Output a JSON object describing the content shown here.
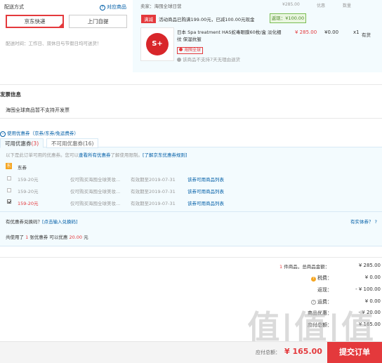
{
  "delivery": {
    "section_label": "配送方式",
    "link_label": "对应商品",
    "options": [
      "京东快递",
      "上门自提"
    ],
    "note": "配送时间：工作日、双休日与节假日均可送货！"
  },
  "shop": {
    "seller_prefix": "卖家：",
    "seller_name": "海囤全球日营",
    "header_cols": [
      "¥285.00",
      "优惠",
      "数量"
    ],
    "promo_tag": "满减",
    "promo_text": "活动商品已购满199.00元，已减100.00元现金",
    "promo_btn": "返现：¥100.00",
    "item": {
      "title": "日本 Spa treatment HAS蛇毒眼膜60枚/盒 淡化细纹 保湿抗皱",
      "price": "¥ 285.00",
      "discount": "¥0.00",
      "qty": "x1",
      "stock": "有货",
      "badge": "海囤全球",
      "return_note": "该商品不支持7天无理由退货",
      "logo_text": "S+"
    }
  },
  "invoice": {
    "title": "发票信息",
    "note": "海囤全球商品暂不支持开发票"
  },
  "coupons": {
    "header": "使用优惠券（京券/东券/免运费券）",
    "tabs": [
      {
        "label": "可用优惠券",
        "count": "(3)"
      },
      {
        "label": "不可用优惠券",
        "count": "(16)"
      }
    ],
    "notice": "以下是此订单可用的优惠券。您可以",
    "notice_link1": "查看所有优惠券",
    "notice_mid": "了解使用限制。",
    "notice_link2": "[了解京东优惠券规则]",
    "group_icon": "东",
    "group_label": "东券",
    "rows": [
      {
        "amount": "159-20元",
        "desc": "仅可购买海囤全球美妆...",
        "expiry": "有效期至2019-07-31",
        "link": "该券可用商品列表",
        "checked": false
      },
      {
        "amount": "159-20元",
        "desc": "仅可购买海囤全球美妆...",
        "expiry": "有效期至2019-07-31",
        "link": "该券可用商品列表",
        "checked": false
      },
      {
        "amount": "159-20元",
        "desc": "仅可购买海囤全球美妆...",
        "expiry": "有效期至2019-07-31",
        "link": "该券可用商品列表",
        "checked": true
      }
    ],
    "exchange_prefix": "有优惠券兑换码？",
    "exchange_link": "[点击输入兑换码]",
    "physical_link": "有实体券？",
    "used_prefix": "共使用了",
    "used_count": "1",
    "used_mid": "张优惠券  可以优惠",
    "used_amount": "20.00",
    "used_suffix": "元"
  },
  "summary": {
    "count_prefix": "1",
    "count_label": "件商品，总商品金额：",
    "total": "¥ 285.00",
    "rows": [
      {
        "label": "税费：",
        "value": "¥ 0.00"
      },
      {
        "label": "返现：",
        "value": "- ¥ 100.00"
      },
      {
        "label": "运费：",
        "value": "¥ 0.00"
      },
      {
        "label": "商品优惠：",
        "value": "- ¥ 20.00"
      },
      {
        "label": "应付总额：",
        "value": "¥ 165.00"
      }
    ]
  },
  "footer": {
    "pay_label": "应付总额：",
    "pay_value": "¥ 165.00",
    "submit": "提交订单"
  },
  "watermark": "值|值|值"
}
